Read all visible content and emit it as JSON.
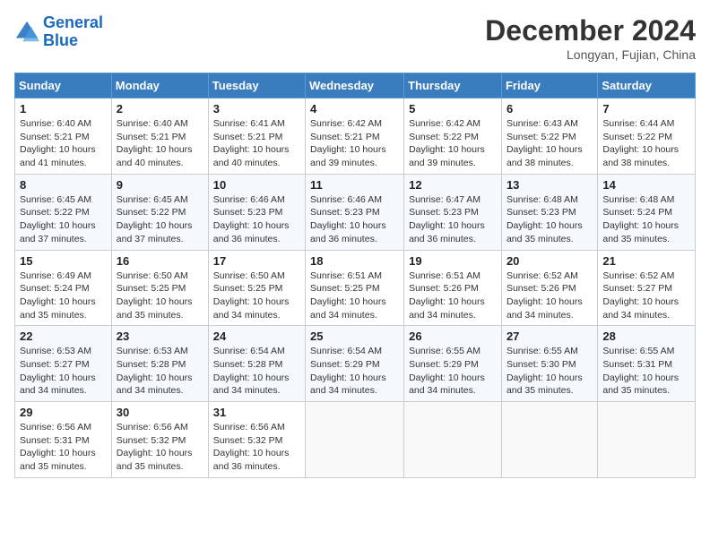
{
  "header": {
    "logo_line1": "General",
    "logo_line2": "Blue",
    "month_title": "December 2024",
    "location": "Longyan, Fujian, China"
  },
  "weekdays": [
    "Sunday",
    "Monday",
    "Tuesday",
    "Wednesday",
    "Thursday",
    "Friday",
    "Saturday"
  ],
  "weeks": [
    [
      {
        "day": "1",
        "info": "Sunrise: 6:40 AM\nSunset: 5:21 PM\nDaylight: 10 hours\nand 41 minutes."
      },
      {
        "day": "2",
        "info": "Sunrise: 6:40 AM\nSunset: 5:21 PM\nDaylight: 10 hours\nand 40 minutes."
      },
      {
        "day": "3",
        "info": "Sunrise: 6:41 AM\nSunset: 5:21 PM\nDaylight: 10 hours\nand 40 minutes."
      },
      {
        "day": "4",
        "info": "Sunrise: 6:42 AM\nSunset: 5:21 PM\nDaylight: 10 hours\nand 39 minutes."
      },
      {
        "day": "5",
        "info": "Sunrise: 6:42 AM\nSunset: 5:22 PM\nDaylight: 10 hours\nand 39 minutes."
      },
      {
        "day": "6",
        "info": "Sunrise: 6:43 AM\nSunset: 5:22 PM\nDaylight: 10 hours\nand 38 minutes."
      },
      {
        "day": "7",
        "info": "Sunrise: 6:44 AM\nSunset: 5:22 PM\nDaylight: 10 hours\nand 38 minutes."
      }
    ],
    [
      {
        "day": "8",
        "info": "Sunrise: 6:45 AM\nSunset: 5:22 PM\nDaylight: 10 hours\nand 37 minutes."
      },
      {
        "day": "9",
        "info": "Sunrise: 6:45 AM\nSunset: 5:22 PM\nDaylight: 10 hours\nand 37 minutes."
      },
      {
        "day": "10",
        "info": "Sunrise: 6:46 AM\nSunset: 5:23 PM\nDaylight: 10 hours\nand 36 minutes."
      },
      {
        "day": "11",
        "info": "Sunrise: 6:46 AM\nSunset: 5:23 PM\nDaylight: 10 hours\nand 36 minutes."
      },
      {
        "day": "12",
        "info": "Sunrise: 6:47 AM\nSunset: 5:23 PM\nDaylight: 10 hours\nand 36 minutes."
      },
      {
        "day": "13",
        "info": "Sunrise: 6:48 AM\nSunset: 5:23 PM\nDaylight: 10 hours\nand 35 minutes."
      },
      {
        "day": "14",
        "info": "Sunrise: 6:48 AM\nSunset: 5:24 PM\nDaylight: 10 hours\nand 35 minutes."
      }
    ],
    [
      {
        "day": "15",
        "info": "Sunrise: 6:49 AM\nSunset: 5:24 PM\nDaylight: 10 hours\nand 35 minutes."
      },
      {
        "day": "16",
        "info": "Sunrise: 6:50 AM\nSunset: 5:25 PM\nDaylight: 10 hours\nand 35 minutes."
      },
      {
        "day": "17",
        "info": "Sunrise: 6:50 AM\nSunset: 5:25 PM\nDaylight: 10 hours\nand 34 minutes."
      },
      {
        "day": "18",
        "info": "Sunrise: 6:51 AM\nSunset: 5:25 PM\nDaylight: 10 hours\nand 34 minutes."
      },
      {
        "day": "19",
        "info": "Sunrise: 6:51 AM\nSunset: 5:26 PM\nDaylight: 10 hours\nand 34 minutes."
      },
      {
        "day": "20",
        "info": "Sunrise: 6:52 AM\nSunset: 5:26 PM\nDaylight: 10 hours\nand 34 minutes."
      },
      {
        "day": "21",
        "info": "Sunrise: 6:52 AM\nSunset: 5:27 PM\nDaylight: 10 hours\nand 34 minutes."
      }
    ],
    [
      {
        "day": "22",
        "info": "Sunrise: 6:53 AM\nSunset: 5:27 PM\nDaylight: 10 hours\nand 34 minutes."
      },
      {
        "day": "23",
        "info": "Sunrise: 6:53 AM\nSunset: 5:28 PM\nDaylight: 10 hours\nand 34 minutes."
      },
      {
        "day": "24",
        "info": "Sunrise: 6:54 AM\nSunset: 5:28 PM\nDaylight: 10 hours\nand 34 minutes."
      },
      {
        "day": "25",
        "info": "Sunrise: 6:54 AM\nSunset: 5:29 PM\nDaylight: 10 hours\nand 34 minutes."
      },
      {
        "day": "26",
        "info": "Sunrise: 6:55 AM\nSunset: 5:29 PM\nDaylight: 10 hours\nand 34 minutes."
      },
      {
        "day": "27",
        "info": "Sunrise: 6:55 AM\nSunset: 5:30 PM\nDaylight: 10 hours\nand 35 minutes."
      },
      {
        "day": "28",
        "info": "Sunrise: 6:55 AM\nSunset: 5:31 PM\nDaylight: 10 hours\nand 35 minutes."
      }
    ],
    [
      {
        "day": "29",
        "info": "Sunrise: 6:56 AM\nSunset: 5:31 PM\nDaylight: 10 hours\nand 35 minutes."
      },
      {
        "day": "30",
        "info": "Sunrise: 6:56 AM\nSunset: 5:32 PM\nDaylight: 10 hours\nand 35 minutes."
      },
      {
        "day": "31",
        "info": "Sunrise: 6:56 AM\nSunset: 5:32 PM\nDaylight: 10 hours\nand 36 minutes."
      },
      null,
      null,
      null,
      null
    ]
  ]
}
